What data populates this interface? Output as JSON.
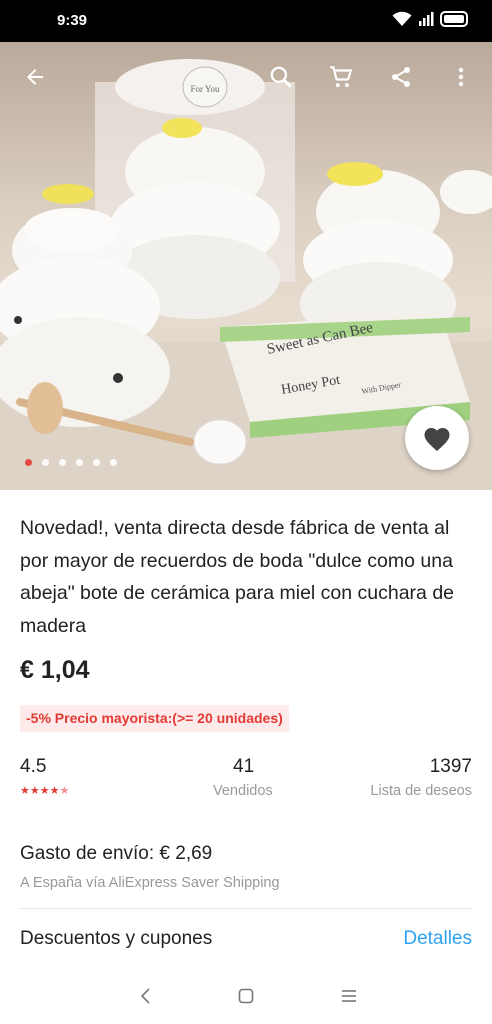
{
  "status_bar": {
    "time": "9:39"
  },
  "product": {
    "title": "Novedad!, venta directa desde fábrica de venta al por mayor de recuerdos de boda \"dulce como una abeja\" bote de cerámica para miel con cuchara de madera",
    "price": "€ 1,04",
    "promo": "-5% Precio mayorista:(>= 20 unidades)",
    "image_text": {
      "tag": "For You",
      "box_line1": "Sweet as Can Bee",
      "box_line2": "Honey Pot",
      "box_line3": "With Dipper"
    },
    "gallery": {
      "count": 6,
      "active": 1
    }
  },
  "stats": {
    "rating": "4.5",
    "rating_stars": 4.5,
    "sold_value": "41",
    "sold_label": "Vendidos",
    "wishlist_value": "1397",
    "wishlist_label": "Lista de deseos"
  },
  "shipping": {
    "title": "Gasto de envío: € 2,69",
    "subtitle": "A España vía AliExpress Saver Shipping"
  },
  "coupons": {
    "title": "Descuentos y cupones",
    "link": "Detalles"
  },
  "icons": {
    "back": "arrow-back-icon",
    "search": "search-icon",
    "cart": "cart-icon",
    "share": "share-icon",
    "more": "more-vert-icon",
    "favorite": "heart-icon"
  },
  "colors": {
    "accent": "#e53935",
    "link": "#2ea3f2",
    "promo_bg": "#fdeaea",
    "muted": "#999999"
  }
}
